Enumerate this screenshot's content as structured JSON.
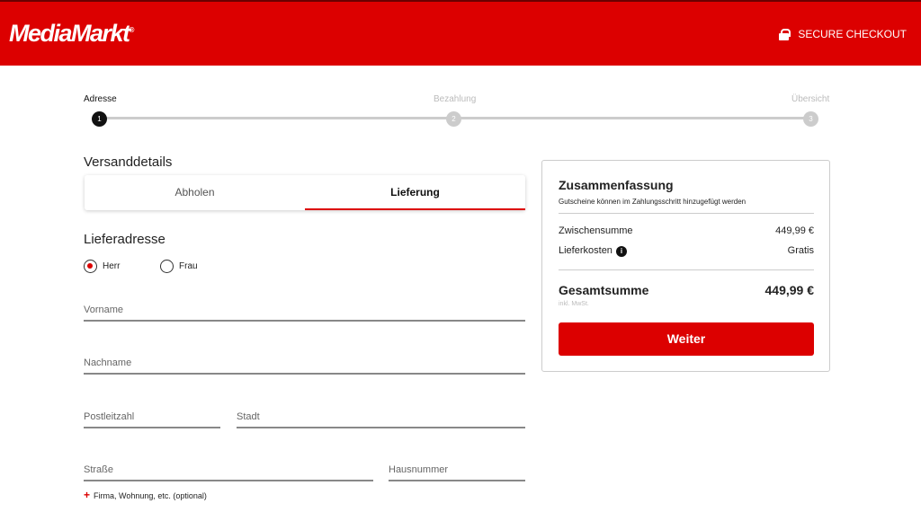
{
  "header": {
    "logo": "MediaMarkt",
    "secure": "SECURE CHECKOUT"
  },
  "steps": [
    {
      "label": "Adresse",
      "num": "1"
    },
    {
      "label": "Bezahlung",
      "num": "2"
    },
    {
      "label": "Übersicht",
      "num": "3"
    }
  ],
  "shipping": {
    "title": "Versanddetails",
    "tabs": [
      "Abholen",
      "Lieferung"
    ],
    "active_tab": "Lieferung"
  },
  "address": {
    "title": "Lieferadresse",
    "salutations": [
      "Herr",
      "Frau"
    ],
    "selected": "Herr",
    "fields": {
      "first": "Vorname",
      "last": "Nachname",
      "zip": "Postleitzahl",
      "city": "Stadt",
      "street": "Straße",
      "number": "Hausnummer"
    },
    "extra": "Firma, Wohnung, etc. (optional)"
  },
  "summary": {
    "title": "Zusammenfassung",
    "subtitle": "Gutscheine können im Zahlungsschritt hinzugefügt werden",
    "subtotal_label": "Zwischensumme",
    "subtotal": "449,99 €",
    "shipping_label": "Lieferkosten",
    "shipping": "Gratis",
    "total_label": "Gesamtsumme",
    "total": "449,99 €",
    "vat": "inkl. MwSt.",
    "button": "Weiter"
  },
  "colors": {
    "brand": "#dc0000"
  }
}
